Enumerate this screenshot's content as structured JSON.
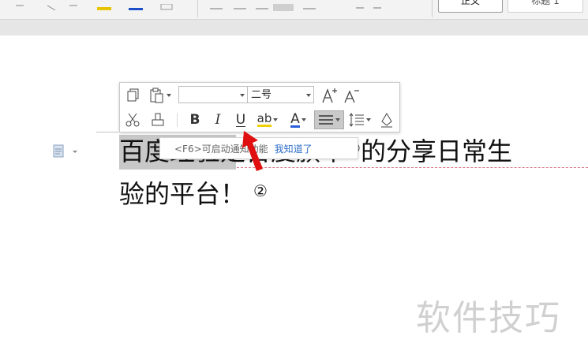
{
  "ribbon": {
    "style_label_1": "正文",
    "style_label_2": "标题 1",
    "accent_color": "#e8c400",
    "font_color_bar": "#1a4fc9"
  },
  "document": {
    "line1_part1": "百度经验",
    "line1_part2": "是百度旗下",
    "line1_mark": "①",
    "line1_part3": "的分享日常生",
    "line2_text": "验的平台！",
    "line2_mark": "②"
  },
  "mini_toolbar": {
    "font_name_value": "",
    "font_size_value": "二号",
    "bold_label": "B",
    "italic_label": "I",
    "underline_label": "U",
    "highlight_label": "ab",
    "font_color_label": "A",
    "highlight_color": "#f2d000",
    "font_color": "#2b5fd9"
  },
  "hint": {
    "text": "<F6>可启动通知功能",
    "link": "我知道了"
  },
  "watermark": "软件技巧",
  "arrow_color": "#e01010"
}
